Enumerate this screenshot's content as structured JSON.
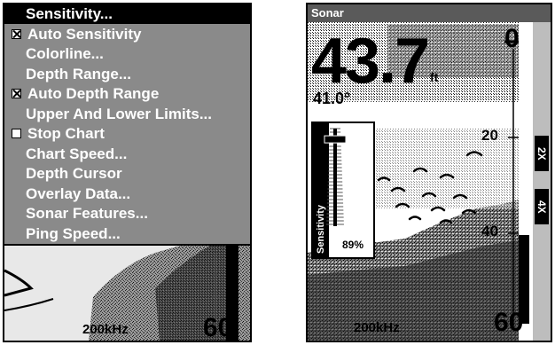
{
  "left": {
    "menu_items": [
      {
        "label": "Sensitivity...",
        "selected": true,
        "checkbox": false
      },
      {
        "label": "Auto Sensitivity",
        "selected": false,
        "checkbox": true,
        "checked": true
      },
      {
        "label": "Colorline...",
        "selected": false,
        "checkbox": false
      },
      {
        "label": "Depth Range...",
        "selected": false,
        "checkbox": false
      },
      {
        "label": "Auto Depth Range",
        "selected": false,
        "checkbox": true,
        "checked": true
      },
      {
        "label": "Upper And Lower Limits...",
        "selected": false,
        "checkbox": false
      },
      {
        "label": "Stop Chart",
        "selected": false,
        "checkbox": true,
        "checked": false
      },
      {
        "label": "Chart Speed...",
        "selected": false,
        "checkbox": false
      },
      {
        "label": "Depth Cursor",
        "selected": false,
        "checkbox": false
      },
      {
        "label": "Overlay Data...",
        "selected": false,
        "checkbox": false
      },
      {
        "label": "Sonar Features...",
        "selected": false,
        "checkbox": false
      },
      {
        "label": "Ping Speed...",
        "selected": false,
        "checkbox": false
      }
    ],
    "frequency": "200kHz",
    "depth_scale_bottom": "60"
  },
  "right": {
    "title": "Sonar",
    "depth": "43.7",
    "depth_unit": "ft",
    "temperature": "41.0°",
    "scale": {
      "top": "0",
      "mid": "20",
      "low": "40",
      "bottom": "60"
    },
    "frequency": "200kHz",
    "zoom_buttons": [
      "2X",
      "4X"
    ],
    "sensitivity": {
      "label": "Sensitivity",
      "value_text": "89%",
      "level": 0.89
    }
  },
  "colors": {
    "menu_bg": "#8a8a8a",
    "selected_bg": "#000000",
    "title_bar": "#5a5a5a",
    "zoom_bar": "#bdbdbd"
  }
}
